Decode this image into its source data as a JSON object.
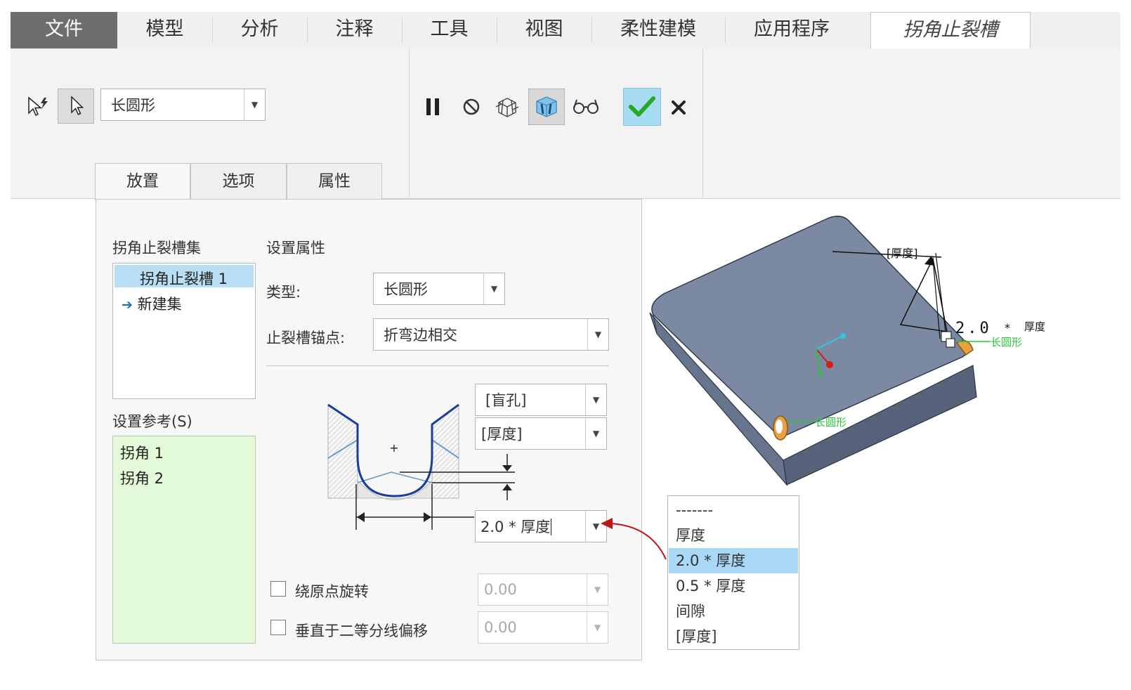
{
  "menubar": {
    "tabs": [
      {
        "label": "文件"
      },
      {
        "label": "模型"
      },
      {
        "label": "分析"
      },
      {
        "label": "注释"
      },
      {
        "label": "工具"
      },
      {
        "label": "视图"
      },
      {
        "label": "柔性建模"
      },
      {
        "label": "应用程序"
      },
      {
        "label": "拐角止裂槽"
      }
    ]
  },
  "ribbon": {
    "shape_value": "长圆形",
    "icons": [
      "smart-select-icon",
      "select-arrow-icon",
      "pause-icon",
      "no-preview-icon",
      "wireframe-preview-icon",
      "verify-preview-icon",
      "glasses-icon",
      "confirm-check-icon",
      "cancel-x-icon"
    ]
  },
  "subtabs": [
    {
      "label": "放置"
    },
    {
      "label": "选项"
    },
    {
      "label": "属性"
    }
  ],
  "panel": {
    "set_title": "拐角止裂槽集",
    "set_items": [
      "拐角止裂槽 1",
      "新建集"
    ],
    "props_title": "设置属性",
    "type_label": "类型:",
    "type_value": "长圆形",
    "anchor_label": "止裂槽锚点:",
    "anchor_value": "折弯边相交",
    "refs_title": "设置参考(S)",
    "refs": [
      "拐角 1",
      "拐角 2"
    ],
    "depth_type": "[盲孔]",
    "depth_value": "[厚度]",
    "width_value": "2.0 * 厚度",
    "rotate_label": "绕原点旋转",
    "rotate_value": "0.00",
    "offset_label": "垂直于二等分线偏移",
    "offset_value": "0.00",
    "diagram_plus": "+"
  },
  "viewport": {
    "dim_thickness": "[厚度]",
    "dim_value": "2.0",
    "dim_mult": "*",
    "dim_unit": "厚度",
    "shape_label_1": "长圆形",
    "shape_label_2": "长圆形"
  },
  "popup": {
    "options": [
      "-------",
      "厚度",
      "2.0 * 厚度",
      "0.5 * 厚度",
      "间隙",
      "[厚度]"
    ],
    "selected": "2.0 * 厚度"
  },
  "colors": {
    "selection": "#a9d9f7",
    "refs_bg": "#e4fbd9",
    "model_top": "#7a8aa0",
    "model_side": "#56627a",
    "relief": "#e8a040",
    "confirm": "#27a827",
    "arrow": "#c0171a"
  }
}
